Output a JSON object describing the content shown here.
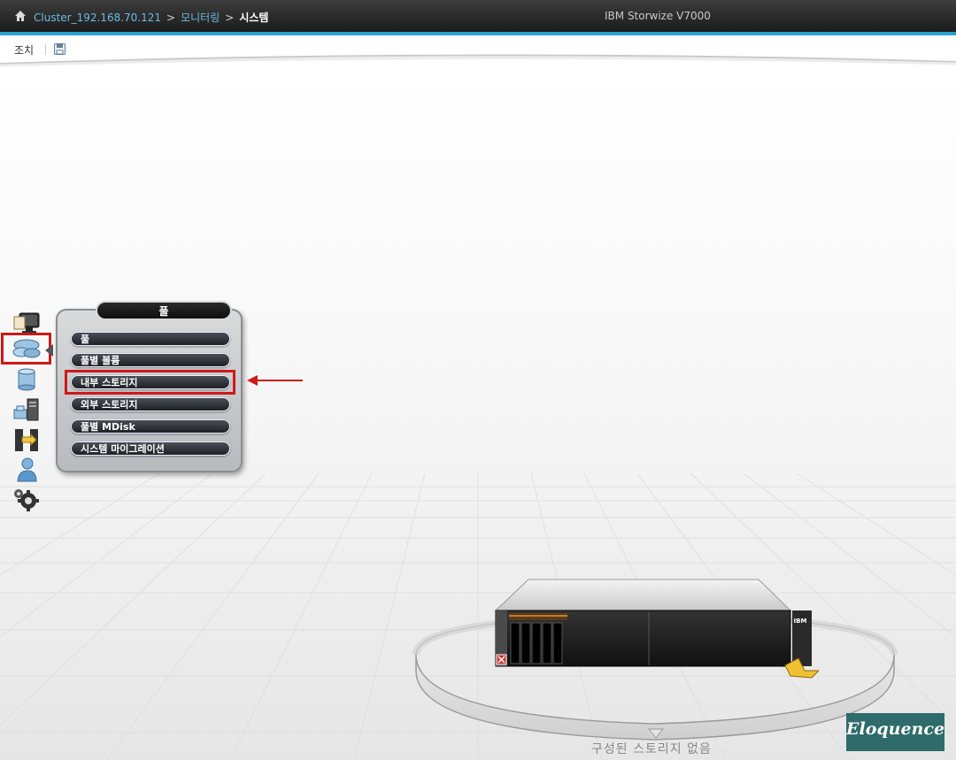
{
  "header": {
    "breadcrumb": {
      "cluster": "Cluster_192.168.70.121",
      "separator": ">",
      "section": "모니터링",
      "current": "시스템"
    },
    "product": "IBM Storwize V7000",
    "accent_color": "#2aa0d0"
  },
  "actionbar": {
    "actions_label": "조치",
    "save_icon": "save-icon"
  },
  "sidebar": {
    "items": [
      {
        "name": "monitoring",
        "icon": "monitor-icon"
      },
      {
        "name": "pools",
        "icon": "pools-icon",
        "selected": true
      },
      {
        "name": "volumes",
        "icon": "volumes-icon"
      },
      {
        "name": "hosts",
        "icon": "hosts-icon"
      },
      {
        "name": "copy-services",
        "icon": "copy-services-icon"
      },
      {
        "name": "access",
        "icon": "user-icon"
      },
      {
        "name": "settings",
        "icon": "gear-icon"
      }
    ]
  },
  "popup": {
    "title": "풀",
    "items": [
      {
        "label": "풀"
      },
      {
        "label": "풀별 볼륨"
      },
      {
        "label": "내부 스토리지",
        "highlighted": true
      },
      {
        "label": "외부 스토리지"
      },
      {
        "label": "풀별 MDisk"
      },
      {
        "label": "시스템 마이그레이션"
      }
    ]
  },
  "storage": {
    "badge": "IBM",
    "status_text": "구성된 스토리지 없음"
  },
  "watermark": {
    "text": "Eloquence",
    "color": "#2e6b6a"
  },
  "highlight_color": "#d01818"
}
